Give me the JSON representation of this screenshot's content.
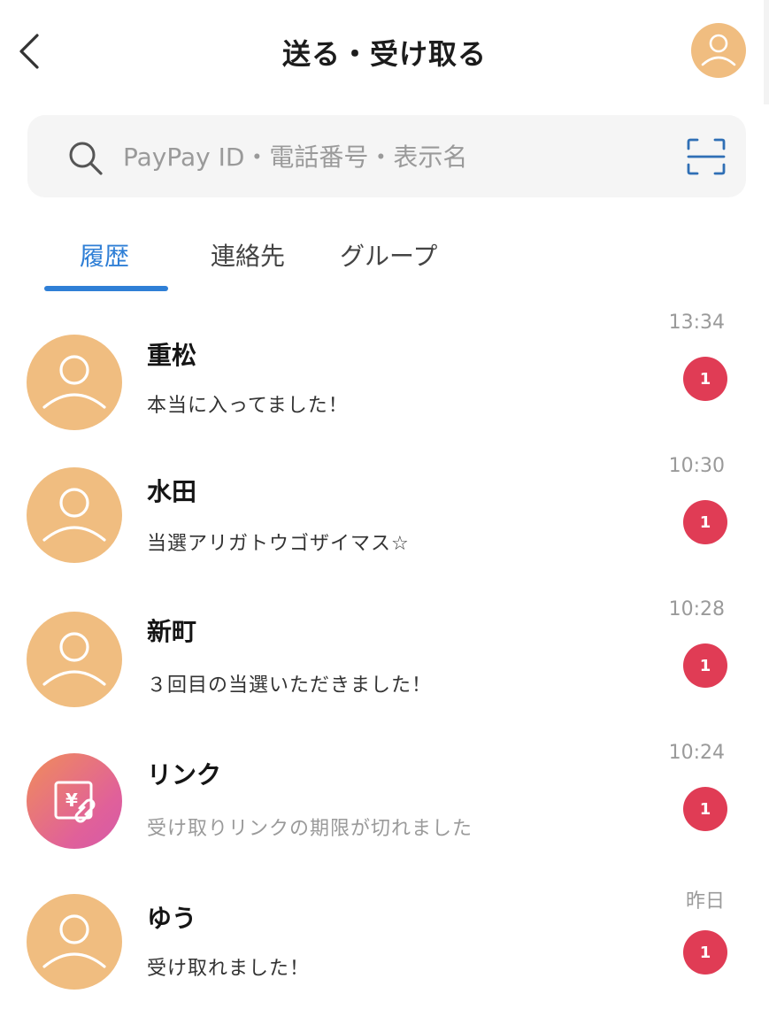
{
  "header": {
    "title": "送る・受け取る",
    "back_icon": "chevron-left-icon",
    "avatar_icon": "user-icon"
  },
  "search": {
    "placeholder": "PayPay ID・電話番号・表示名",
    "search_icon": "search-icon",
    "scan_icon": "scan-icon"
  },
  "tabs": [
    {
      "label": "履歴",
      "active": true
    },
    {
      "label": "連絡先",
      "active": false
    },
    {
      "label": "グループ",
      "active": false
    }
  ],
  "history": [
    {
      "name": "重松",
      "message": "本当に入ってました！",
      "time": "13:34",
      "badge": "1",
      "avatar": "user-icon"
    },
    {
      "name": "水田",
      "message": "当選アリガトウゴザイマス☆",
      "time": "10:30",
      "badge": "1",
      "avatar": "user-icon"
    },
    {
      "name": "新町",
      "message": "３回目の当選いただきました！",
      "time": "10:28",
      "badge": "1",
      "avatar": "user-icon"
    },
    {
      "name": "リンク",
      "message": "受け取りリンクの期限が切れました",
      "time": "10:24",
      "badge": "1",
      "avatar": "yen-link-icon"
    },
    {
      "name": "ゆう",
      "message": "受け取れました！",
      "time": "昨日",
      "badge": "1",
      "avatar": "user-icon"
    }
  ],
  "colors": {
    "accent": "#2f7fd6",
    "badge": "#e03c55",
    "avatar": "#f0bd80"
  }
}
